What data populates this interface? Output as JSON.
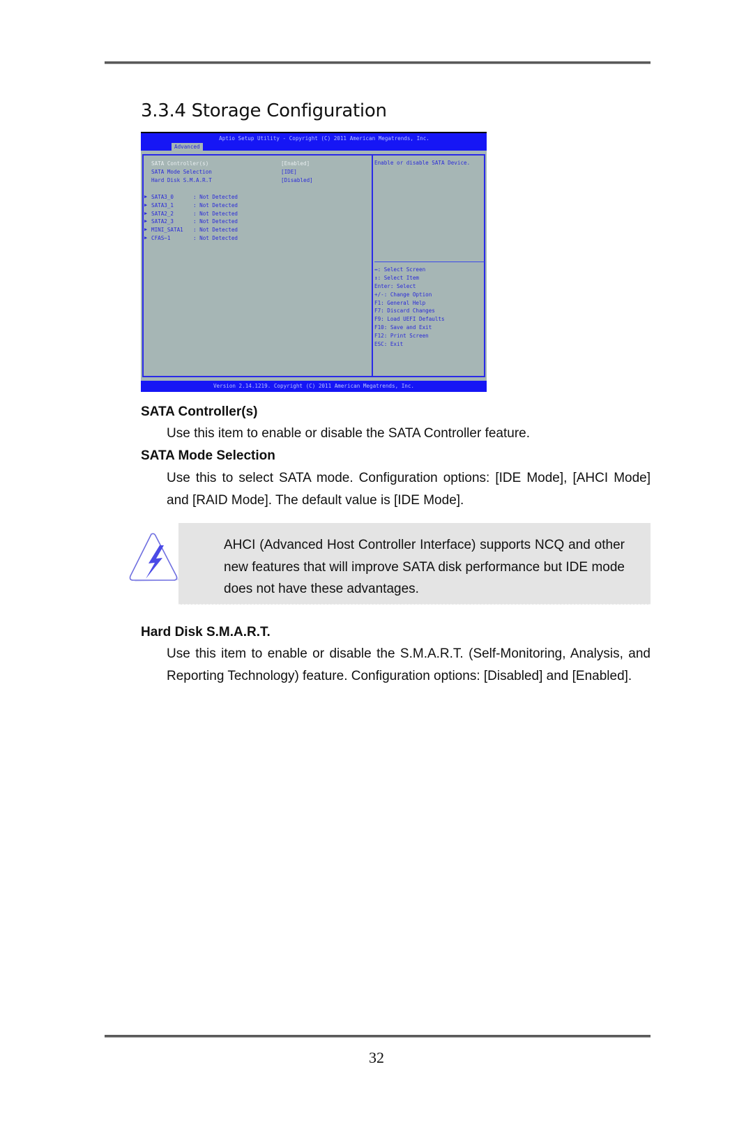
{
  "section": {
    "number": "3.3.4",
    "title": "3.3.4  Storage Configuration"
  },
  "bios": {
    "header_title": "Aptio Setup Utility - Copyright (C) 2011 American Megatrends, Inc.",
    "active_tab": "Advanced",
    "settings": [
      {
        "label": "SATA Controller(s)",
        "value": "[Enabled]",
        "selected": true
      },
      {
        "label": "SATA Mode Selection",
        "value": "[IDE]",
        "selected": false
      },
      {
        "label": "Hard Disk S.M.A.R.T",
        "value": "[Disabled]",
        "selected": false
      }
    ],
    "devices": [
      {
        "name": "SATA3_0",
        "status": ": Not Detected"
      },
      {
        "name": "SATA3_1",
        "status": ": Not Detected"
      },
      {
        "name": "SATA2_2",
        "status": ": Not Detected"
      },
      {
        "name": "SATA2_3",
        "status": ": Not Detected"
      },
      {
        "name": "MINI_SATA1",
        "status": ": Not Detected"
      },
      {
        "name": "CFAS~1",
        "status": ": Not Detected"
      }
    ],
    "submenu_arrow": "▶",
    "help_text": "Enable or disable SATA Device.",
    "key_help": [
      "↔: Select Screen",
      "↕: Select Item",
      "Enter: Select",
      "+/-: Change Option",
      "F1: General Help",
      "F7: Discard Changes",
      "F9: Load UEFI Defaults",
      "F10: Save and Exit",
      "F12: Print Screen",
      "ESC: Exit"
    ],
    "footer": "Version 2.14.1219. Copyright (C) 2011 American Megatrends, Inc.",
    "colors": {
      "bar_blue": "#1616f5",
      "panel_grey": "#a6b6b5",
      "text_blue": "#2a2ad8",
      "selected_text": "#e8eef0"
    }
  },
  "items": [
    {
      "heading": "SATA Controller(s)",
      "body": "Use this item to enable or disable the SATA Controller feature."
    },
    {
      "heading": "SATA Mode Selection",
      "body": "Use this to select SATA mode. Configuration options: [IDE Mode], [AHCI Mode] and [RAID Mode]. The default value is [IDE Mode]."
    },
    {
      "heading": "Hard Disk S.M.A.R.T.",
      "body": "Use this item to enable or disable the S.M.A.R.T. (Self-Monitoring, Analysis, and Reporting Technology) feature. Configuration options: [Disabled] and [Enabled]."
    }
  ],
  "note": {
    "icon": "warning-lightning-icon",
    "text": "AHCI (Advanced Host Controller Interface) supports NCQ and other new features that will improve SATA disk performance but IDE mode does not have these advantages."
  },
  "page_number": "32"
}
